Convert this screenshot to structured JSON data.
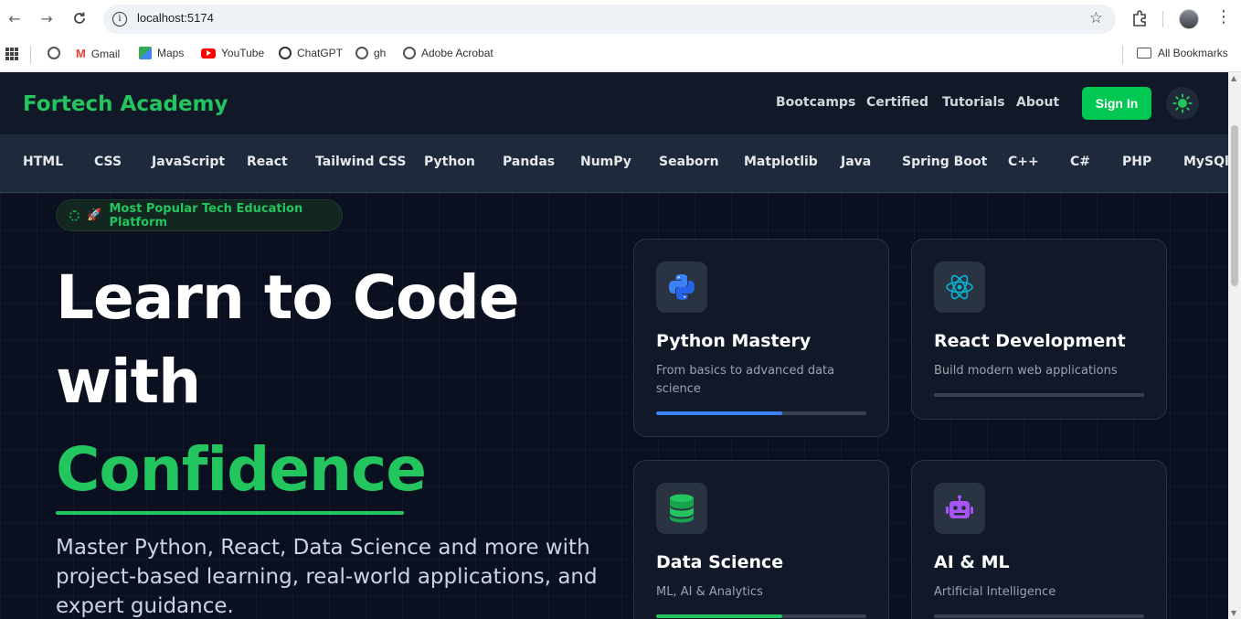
{
  "browser": {
    "url": "localhost:5174",
    "bookmarks": [
      "Gmail",
      "Maps",
      "YouTube",
      "ChatGPT",
      "gh",
      "Adobe Acrobat"
    ],
    "all_bookmarks": "All Bookmarks"
  },
  "header": {
    "brand": "Fortech Academy",
    "links": [
      "Bootcamps",
      "Certified",
      "Tutorials",
      "About"
    ],
    "signin": "Sign In"
  },
  "topics": [
    "HTML",
    "CSS",
    "JavaScript",
    "React",
    "Tailwind CSS",
    "Python",
    "Pandas",
    "NumPy",
    "Seaborn",
    "Matplotlib",
    "Java",
    "Spring Boot",
    "C++",
    "C#",
    "PHP",
    "MySQl"
  ],
  "hero": {
    "badge_emoji": "🚀",
    "badge": "Most Popular Tech Education Platform",
    "line1": "Learn to Code",
    "line2": "with",
    "line3": "Confidence",
    "lead": "Master Python, React, Data Science and more with project-based learning, real-world applications, and expert guidance."
  },
  "cards": [
    {
      "title": "Python Mastery",
      "desc": "From basics to advanced data science",
      "icon": "python-icon",
      "progress": 0.6,
      "color": "#3b82f6"
    },
    {
      "title": "React Development",
      "desc": "Build modern web applications",
      "icon": "react-icon",
      "progress": 0.0,
      "color": "#06b6d4"
    },
    {
      "title": "Data Science",
      "desc": "ML, AI & Analytics",
      "icon": "database-icon",
      "progress": 0.6,
      "color": "#22c55e"
    },
    {
      "title": "AI & ML",
      "desc": "Artificial Intelligence",
      "icon": "robot-icon",
      "progress": 0.0,
      "color": "#a855f7"
    }
  ],
  "colors": {
    "accent": "#22c55e",
    "signin": "#00c853",
    "bg": "#0b1020"
  }
}
